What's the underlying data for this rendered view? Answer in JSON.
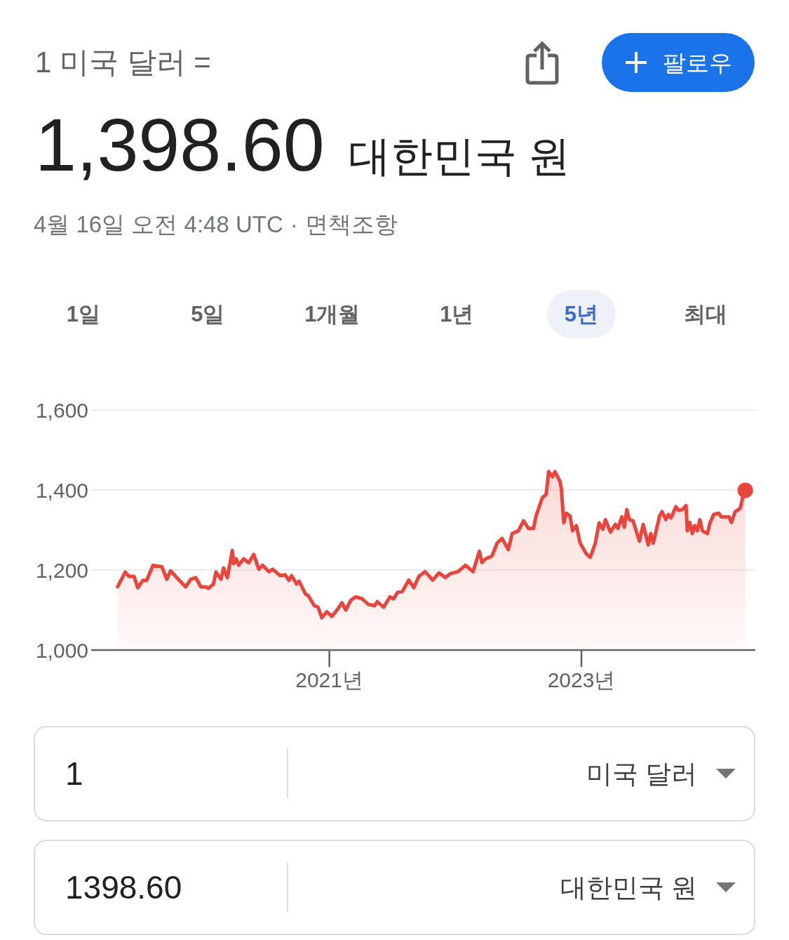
{
  "header": {
    "base_label": "1 미국 달러 =",
    "follow_button": "팔로우"
  },
  "rate": {
    "value": "1,398.60",
    "currency": "대한민국 원"
  },
  "meta": {
    "timestamp": "4월 16일 오전 4:48 UTC",
    "separator": "·",
    "disclaimer_link": "면책조항"
  },
  "range_tabs": [
    {
      "label": "1일",
      "selected": false
    },
    {
      "label": "5일",
      "selected": false
    },
    {
      "label": "1개월",
      "selected": false
    },
    {
      "label": "1년",
      "selected": false
    },
    {
      "label": "5년",
      "selected": true
    },
    {
      "label": "최대",
      "selected": false
    }
  ],
  "chart": {
    "chart_data": {
      "type": "area",
      "x": [
        2019.32,
        2019.38,
        2019.41,
        2019.45,
        2019.48,
        2019.52,
        2019.55,
        2019.6,
        2019.65,
        2019.67,
        2019.71,
        2019.74,
        2019.81,
        2019.86,
        2019.9,
        2019.94,
        2019.98,
        2020.02,
        2020.04,
        2020.08,
        2020.1,
        2020.14,
        2020.16,
        2020.19,
        2020.23,
        2020.24,
        2020.26,
        2020.28,
        2020.32,
        2020.36,
        2020.4,
        2020.44,
        2020.47,
        2020.52,
        2020.55,
        2020.61,
        2020.65,
        2020.68,
        2020.7,
        2020.74,
        2020.76,
        2020.81,
        2020.83,
        2020.88,
        2020.91,
        2020.94,
        2020.98,
        2021.02,
        2021.07,
        2021.1,
        2021.13,
        2021.17,
        2021.21,
        2021.26,
        2021.31,
        2021.36,
        2021.38,
        2021.43,
        2021.48,
        2021.51,
        2021.54,
        2021.58,
        2021.63,
        2021.67,
        2021.71,
        2021.76,
        2021.82,
        2021.87,
        2021.92,
        2021.96,
        2022.02,
        2022.08,
        2022.14,
        2022.19,
        2022.21,
        2022.24,
        2022.29,
        2022.33,
        2022.37,
        2022.42,
        2022.45,
        2022.5,
        2022.54,
        2022.58,
        2022.62,
        2022.64,
        2022.69,
        2022.72,
        2022.74,
        2022.77,
        2022.79,
        2022.83,
        2022.84,
        2022.86,
        2022.88,
        2022.91,
        2022.93,
        2022.96,
        2022.99,
        2023.04,
        2023.07,
        2023.11,
        2023.14,
        2023.17,
        2023.19,
        2023.23,
        2023.27,
        2023.29,
        2023.32,
        2023.34,
        2023.36,
        2023.38,
        2023.41,
        2023.46,
        2023.49,
        2023.53,
        2023.55,
        2023.57,
        2023.62,
        2023.64,
        2023.67,
        2023.69,
        2023.71,
        2023.75,
        2023.77,
        2023.8,
        2023.83,
        2023.84,
        2023.86,
        2023.88,
        2023.9,
        2023.92,
        2023.94,
        2023.96,
        2024.0,
        2024.02,
        2024.05,
        2024.09,
        2024.11,
        2024.17,
        2024.19,
        2024.22,
        2024.26,
        2024.28,
        2024.3
      ],
      "values": [
        1158,
        1195,
        1184,
        1184,
        1156,
        1174,
        1174,
        1212,
        1209,
        1209,
        1177,
        1198,
        1174,
        1158,
        1177,
        1181,
        1158,
        1158,
        1154,
        1165,
        1195,
        1177,
        1205,
        1181,
        1249,
        1216,
        1228,
        1212,
        1228,
        1218,
        1239,
        1202,
        1212,
        1196,
        1202,
        1186,
        1188,
        1174,
        1186,
        1165,
        1172,
        1140,
        1137,
        1111,
        1107,
        1081,
        1096,
        1084,
        1104,
        1118,
        1100,
        1125,
        1133,
        1128,
        1114,
        1111,
        1121,
        1107,
        1133,
        1128,
        1144,
        1147,
        1175,
        1156,
        1184,
        1196,
        1175,
        1193,
        1181,
        1191,
        1196,
        1212,
        1196,
        1247,
        1219,
        1228,
        1235,
        1267,
        1279,
        1251,
        1291,
        1298,
        1323,
        1304,
        1304,
        1335,
        1381,
        1389,
        1446,
        1433,
        1446,
        1421,
        1405,
        1318,
        1342,
        1335,
        1298,
        1311,
        1267,
        1240,
        1232,
        1267,
        1318,
        1302,
        1326,
        1295,
        1314,
        1304,
        1333,
        1307,
        1351,
        1326,
        1323,
        1272,
        1314,
        1263,
        1291,
        1267,
        1335,
        1346,
        1326,
        1339,
        1330,
        1358,
        1349,
        1351,
        1361,
        1298,
        1319,
        1291,
        1311,
        1298,
        1326,
        1298,
        1291,
        1318,
        1339,
        1342,
        1333,
        1333,
        1319,
        1346,
        1354,
        1382,
        1399
      ],
      "xlim": [
        2019.11,
        2024.38
      ],
      "ylim": [
        1000,
        1600
      ],
      "xticks": [
        {
          "value": 2021,
          "label": "2021년"
        },
        {
          "value": 2023,
          "label": "2023년"
        }
      ],
      "yticks": [
        {
          "value": 1000,
          "label": "1,000"
        },
        {
          "value": 1200,
          "label": "1,200"
        },
        {
          "value": 1400,
          "label": "1,400"
        },
        {
          "value": 1600,
          "label": "1,600"
        }
      ]
    }
  },
  "converter": [
    {
      "amount": "1",
      "currency": "미국 달러"
    },
    {
      "amount": "1398.60",
      "currency": "대한민국 원"
    }
  ]
}
